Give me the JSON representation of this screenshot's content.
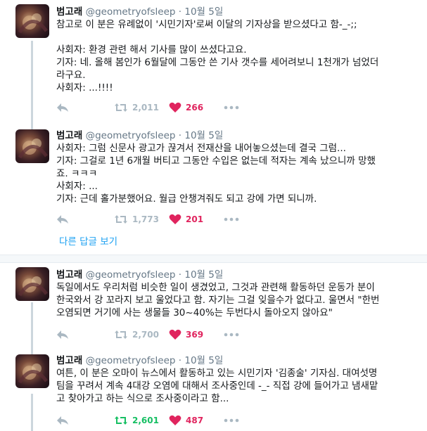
{
  "tweets": [
    {
      "name": "범고래",
      "handle": "@geometryofsleep",
      "separator": "·",
      "time": "10월 5일",
      "lines": [
        "참고로 이 분은 유례없이 '시민기자'로써 이달의 기자상을 받으셨다고 함-_-;;",
        "",
        "사회자: 환경 관련 해서 기사를 많이 쓰셨다고요.",
        "기자: 네. 올해 봄인가 6월달에 그동안 쓴 기사 갯수를 세어려보니 1천개가 넘었더",
        "라구요.",
        "사회자: ...!!!!"
      ],
      "retweets": "2,011",
      "likes": "266"
    },
    {
      "name": "범고래",
      "handle": "@geometryofsleep",
      "separator": "·",
      "time": "10월 5일",
      "lines": [
        "사회자: 그럼 신문사 광고가 끊겨서 전재산을 내어놓으셨는데 결국 그럼...",
        "기자: 그걸로 1년 6개월 버티고 그동안 수입은 없는데 적자는 계속 났으니까 망했",
        "죠. ㅋㅋㅋ",
        "사회자: ...",
        "기자: 근데 홀가분했어요. 월급 안챙겨줘도 되고 강에 가면 되니까."
      ],
      "retweets": "1,773",
      "likes": "201"
    },
    {
      "name": "범고래",
      "handle": "@geometryofsleep",
      "separator": "·",
      "time": "10월 5일",
      "lines": [
        "독일에서도 우리처럼 비슷한 일이 생겼었고, 그것과 관련해 활동하던 운동가 분이",
        "한국와서 강 꼬라지 보고 울었다고 함. 자기는 그걸 잊을수가 없다고. 울면서 \"한번",
        "오염되면 거기에 사는 생물들 30~40%는 두번다시 돌아오지 않아요\""
      ],
      "retweets": "2,700",
      "likes": "369"
    },
    {
      "name": "범고래",
      "handle": "@geometryofsleep",
      "separator": "·",
      "time": "10월 5일",
      "lines": [
        "여튼, 이 분은 오마이 뉴스에서 활동하고 있는 시민기자 '김종술' 기자심. 대여섯명",
        "팀을 꾸려서 계속 4대강 오염에 대해서 조사중인데 -_- 직접 강에 들어가고 냄새맡",
        "고 찾아가고 하는 식으로 조사중이라고 함..."
      ],
      "retweets": "2,601",
      "likes": "487"
    }
  ],
  "more_replies_label": "다른 답글 보기",
  "icons": {
    "reply": "reply-icon",
    "retweet": "retweet-icon",
    "like": "heart-icon",
    "more": "more-icon"
  },
  "colors": {
    "link": "#1da1f2",
    "like": "#e0245e",
    "retweet_active": "#17bf63",
    "muted": "#657786",
    "icon": "#aab8c2"
  }
}
